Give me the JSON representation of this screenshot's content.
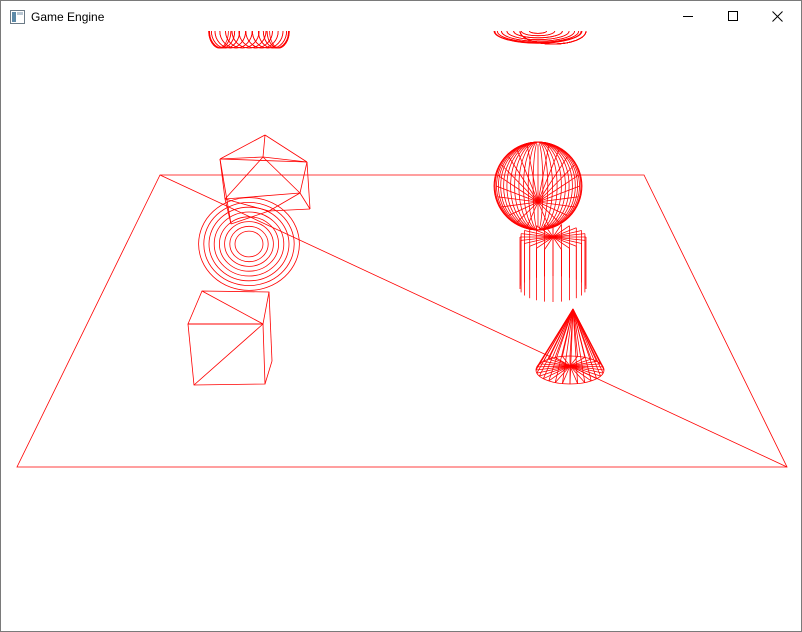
{
  "window": {
    "title": "Game Engine",
    "icon": "app-window-icon",
    "controls": [
      "minimize-icon",
      "maximize-icon",
      "close-icon"
    ]
  },
  "scene": {
    "render_mode": "wireframe",
    "line_color": "#ff0000",
    "background": "#ffffff",
    "objects": [
      "plane",
      "icosahedron",
      "torus",
      "cube",
      "sphere",
      "cylinder",
      "cone"
    ]
  }
}
